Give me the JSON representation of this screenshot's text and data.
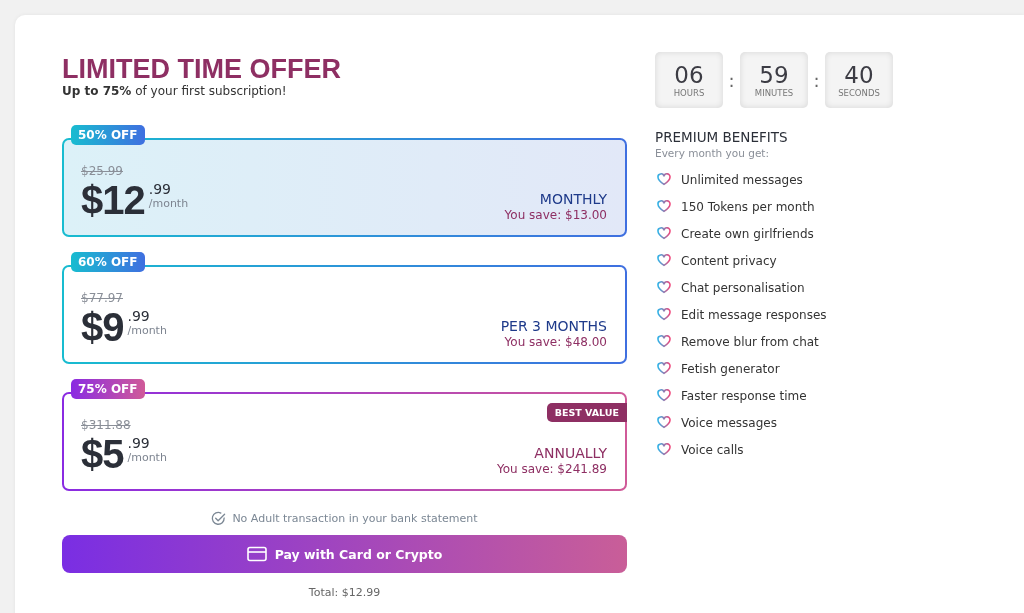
{
  "offer": {
    "title": "LIMITED TIME OFFER",
    "subtitle": "**Up to 75%** of your first subscription!"
  },
  "plans": [
    {
      "kind": "standard",
      "selected": true,
      "badge": "50% OFF",
      "old_price": "$25.99",
      "price": "$12",
      "cents": ".99",
      "unit": "/month",
      "period": "MONTHLY",
      "savings": "You save: $13.00"
    },
    {
      "kind": "standard",
      "selected": false,
      "badge": "60% OFF",
      "old_price": "$77.97",
      "price": "$9",
      "cents": ".99",
      "unit": "/month",
      "period": "PER 3 MONTHS",
      "savings": "You save: $48.00"
    },
    {
      "kind": "featured",
      "selected": false,
      "badge": "75% OFF",
      "ribbon": "BEST VALUE",
      "old_price": "$311.88",
      "price": "$5",
      "cents": ".99",
      "unit": "/month",
      "period": "ANNUALLY",
      "savings": "You save: $241.89"
    }
  ],
  "notice": "No Adult transaction in your bank statement",
  "pay_button": "Pay with Card or Crypto",
  "total": "Total: $12.99",
  "timer": [
    {
      "value": "06",
      "unit": "HOURS"
    },
    {
      "value": "59",
      "unit": "MINUTES"
    },
    {
      "value": "40",
      "unit": "SECONDS"
    }
  ],
  "timer_separator": ":",
  "benefits": {
    "title": "PREMIUM BENEFITS",
    "subtitle": "Every month you get:",
    "items": [
      "Unlimited messages",
      "150 Tokens per month",
      "Create own girlfriends",
      "Content privacy",
      "Chat personalisation",
      "Edit message responses",
      "Remove blur from chat",
      "Fetish generator",
      "Faster response time",
      "Voice messages",
      "Voice calls"
    ]
  }
}
